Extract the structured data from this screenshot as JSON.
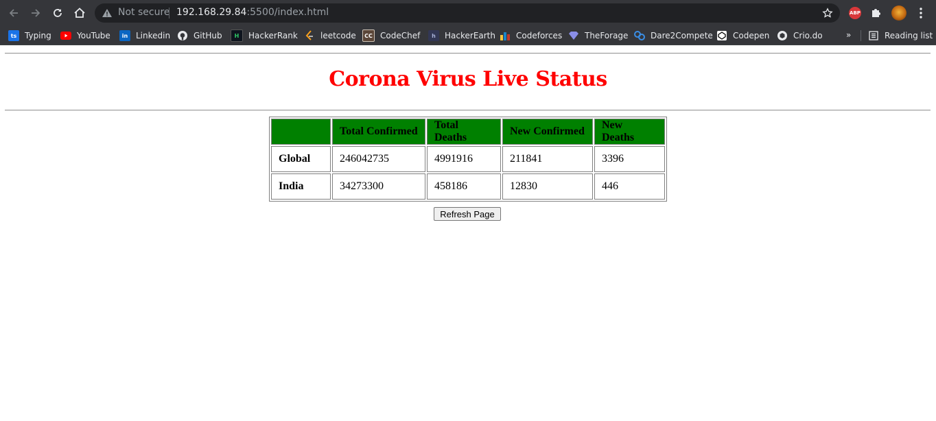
{
  "browser": {
    "security_label": "Not secure",
    "url_host": "192.168.29.84",
    "url_rest": ":5500/index.html",
    "abp_label": "ABP",
    "bookmarks": [
      {
        "label": "Typing",
        "icon": "typing-icon"
      },
      {
        "label": "YouTube",
        "icon": "youtube-icon"
      },
      {
        "label": "Linkedin",
        "icon": "linkedin-icon"
      },
      {
        "label": "GitHub",
        "icon": "github-icon"
      },
      {
        "label": "HackerRank",
        "icon": "hackerrank-icon"
      },
      {
        "label": "leetcode",
        "icon": "leetcode-icon"
      },
      {
        "label": "CodeChef",
        "icon": "codechef-icon"
      },
      {
        "label": "HackerEarth",
        "icon": "hackerearth-icon"
      },
      {
        "label": "Codeforces",
        "icon": "codeforces-icon"
      },
      {
        "label": "TheForage",
        "icon": "theforage-icon"
      },
      {
        "label": "Dare2Compete",
        "icon": "dare2compete-icon"
      },
      {
        "label": "Codepen",
        "icon": "codepen-icon"
      },
      {
        "label": "Crio.do",
        "icon": "crio-icon"
      }
    ],
    "more_label": "»",
    "reading_list_label": "Reading list"
  },
  "page": {
    "title": "Corona Virus Live Status",
    "table": {
      "headers": [
        "",
        "Total Confirmed",
        "Total Deaths",
        "New Confirmed",
        "New Deaths"
      ],
      "rows": [
        [
          "Global",
          "246042735",
          "4991916",
          "211841",
          "3396"
        ],
        [
          "India",
          "34273300",
          "458186",
          "12830",
          "446"
        ]
      ]
    },
    "refresh_button": "Refresh Page"
  },
  "colors": {
    "title": "#ff0000",
    "header_bg": "#008000",
    "chrome_bg": "#35363a"
  }
}
